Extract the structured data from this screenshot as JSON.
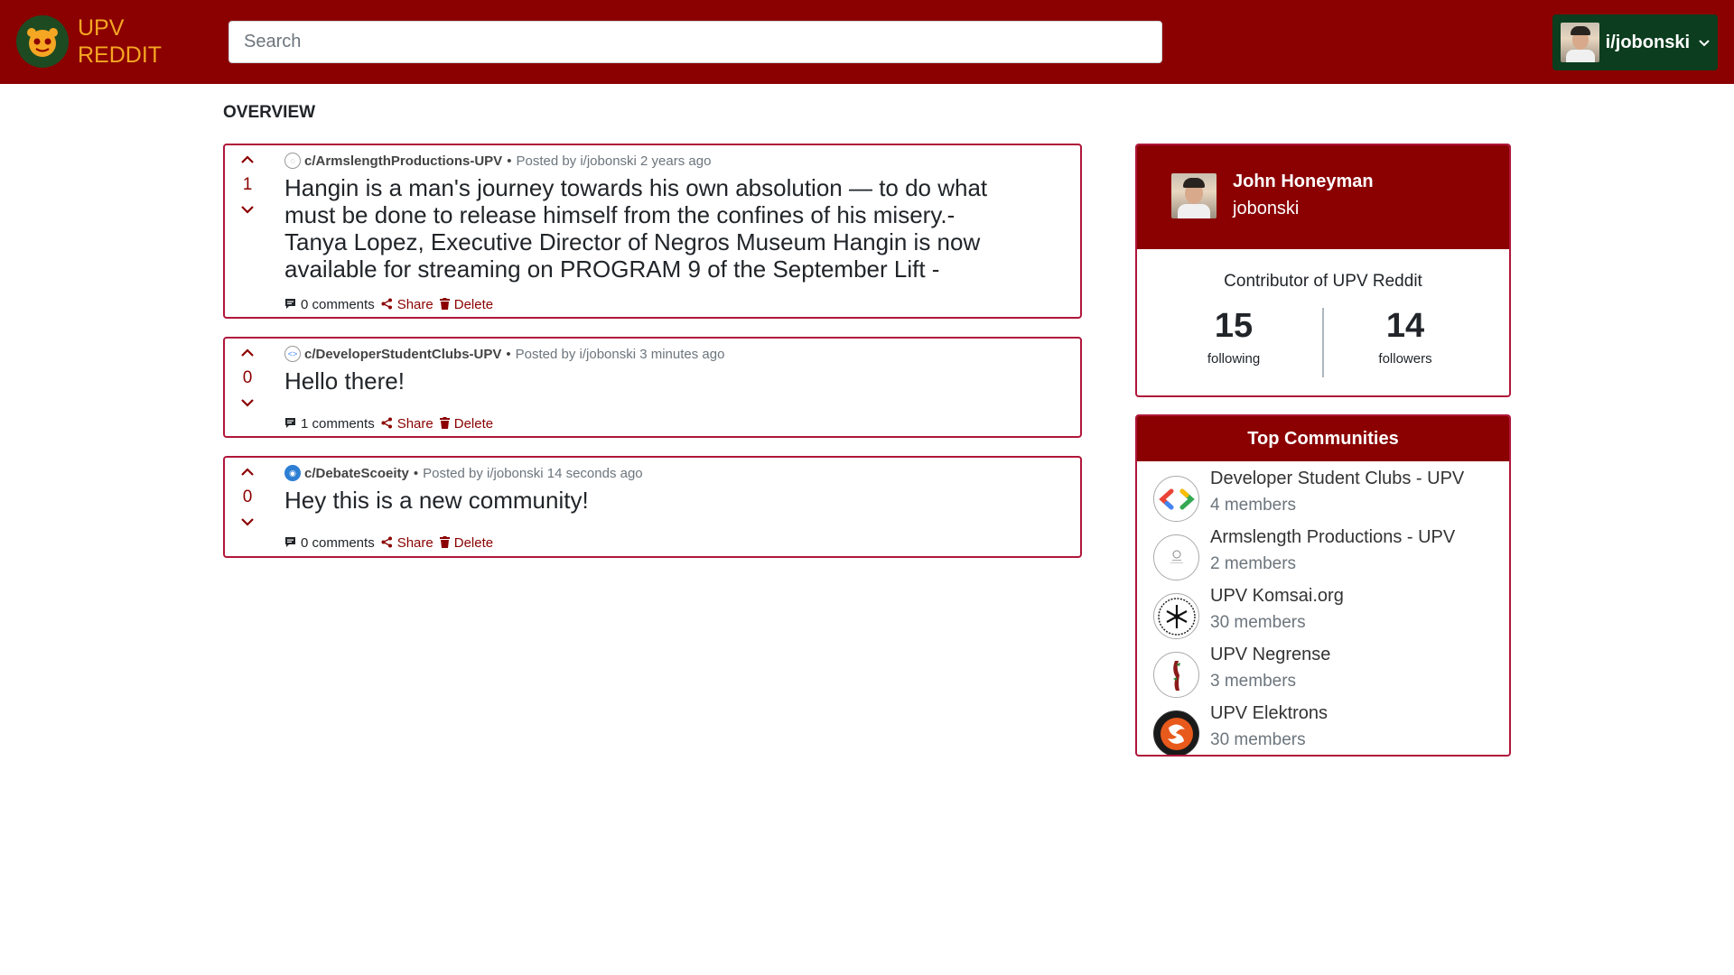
{
  "brand": {
    "line1": "UPV",
    "line2": "REDDIT"
  },
  "search": {
    "placeholder": "Search",
    "value": ""
  },
  "user_menu": {
    "username": "i/jobonski"
  },
  "overview": {
    "title": "OVERVIEW"
  },
  "posts": [
    {
      "community": "c/ArmslengthProductions-UPV",
      "posted_by": "Posted by i/jobonski 2 years ago",
      "votes": "1",
      "title": "Hangin is a man's journey towards his own absolution — to do what must be done to release himself from the confines of his misery.-Tanya Lopez, Executive Director of Negros Museum Hangin is now available for streaming on PROGRAM 9 of the September Lift -",
      "comments": "0 comments",
      "share": "Share",
      "delete": "Delete"
    },
    {
      "community": "c/DeveloperStudentClubs-UPV",
      "posted_by": "Posted by i/jobonski 3 minutes ago",
      "votes": "0",
      "title": "Hello there!",
      "comments": "1 comments",
      "share": "Share",
      "delete": "Delete"
    },
    {
      "community": "c/DebateScoeity",
      "posted_by": "Posted by i/jobonski 14 seconds ago",
      "votes": "0",
      "title": "Hey this is a new community!",
      "comments": "0 comments",
      "share": "Share",
      "delete": "Delete"
    }
  ],
  "profile": {
    "name": "John Honeyman",
    "handle": "jobonski",
    "role": "Contributor of UPV Reddit",
    "following": "15",
    "following_label": "following",
    "followers": "14",
    "followers_label": "followers"
  },
  "top_communities": {
    "title": "Top Communities",
    "items": [
      {
        "name": "Developer Student Clubs - UPV",
        "members": "4 members"
      },
      {
        "name": "Armslength Productions - UPV",
        "members": "2 members"
      },
      {
        "name": "UPV Komsai.org",
        "members": "30 members"
      },
      {
        "name": "UPV Negrense",
        "members": "3 members"
      },
      {
        "name": "UPV Elektrons",
        "members": "30 members"
      }
    ]
  },
  "colors": {
    "primary": "#8b0000",
    "accent": "#f5a623",
    "user_button": "#0b3d1e",
    "border": "#b0163a"
  },
  "icons": [
    "upv-reddit-logo-icon",
    "caret-down-icon",
    "upvote-icon",
    "downvote-icon",
    "comment-icon",
    "share-icon",
    "trash-icon"
  ]
}
